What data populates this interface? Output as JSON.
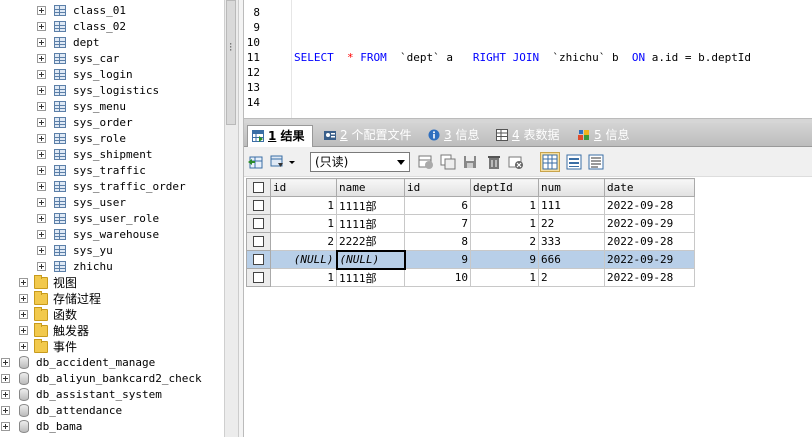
{
  "tree": {
    "tables": [
      "class_01",
      "class_02",
      "dept",
      "sys_car",
      "sys_login",
      "sys_logistics",
      "sys_menu",
      "sys_order",
      "sys_role",
      "sys_shipment",
      "sys_traffic",
      "sys_traffic_order",
      "sys_user",
      "sys_user_role",
      "sys_warehouse",
      "sys_yu",
      "zhichu"
    ],
    "folders": [
      "视图",
      "存储过程",
      "函数",
      "触发器",
      "事件"
    ],
    "databases": [
      "db_accident_manage",
      "db_aliyun_bankcard2_check",
      "db_assistant_system",
      "db_attendance",
      "db_bama"
    ]
  },
  "editor": {
    "line_numbers": [
      "8",
      "9",
      "10",
      "11",
      "12",
      "13",
      "14"
    ],
    "sql": {
      "select": "SELECT",
      "star": "*",
      "from": "FROM",
      "t1": "`dept`",
      "a": "a",
      "right_join": "RIGHT JOIN",
      "t2": "`zhichu`",
      "b": "b",
      "on": "ON",
      "cond": "a.id = b.deptId"
    }
  },
  "tabs": [
    {
      "num": "1",
      "label": "结果"
    },
    {
      "num": "2",
      "label": "个配置文件"
    },
    {
      "num": "3",
      "label": "信息"
    },
    {
      "num": "4",
      "label": "表数据"
    },
    {
      "num": "5",
      "label": "信息"
    }
  ],
  "toolbar": {
    "mode_select": "(只读)"
  },
  "grid": {
    "columns": [
      "id",
      "name",
      "id",
      "deptId",
      "num",
      "date"
    ],
    "rows": [
      [
        "1",
        "1111部",
        "6",
        "1",
        "111",
        "2022-09-28"
      ],
      [
        "1",
        "1111部",
        "7",
        "1",
        "22",
        "2022-09-29"
      ],
      [
        "2",
        "2222部",
        "8",
        "2",
        "333",
        "2022-09-28"
      ],
      [
        "(NULL)",
        "(NULL)",
        "9",
        "9",
        "666",
        "2022-09-29"
      ],
      [
        "1",
        "1111部",
        "10",
        "1",
        "2",
        "2022-09-28"
      ]
    ]
  },
  "colors": {
    "keyword": "#0000ff",
    "operator": "#ff0000",
    "selected_row": "#b8cfe8"
  }
}
